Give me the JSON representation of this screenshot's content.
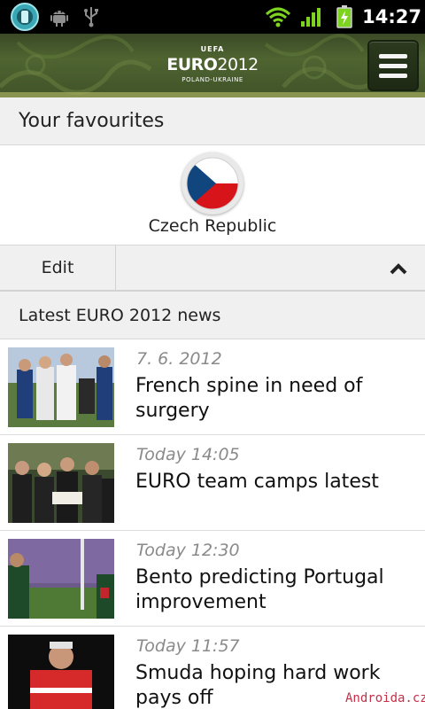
{
  "status_bar": {
    "time": "14:27",
    "icons": [
      "app-notification-icon",
      "android-debug-icon",
      "usb-icon",
      "wifi-icon",
      "signal-icon",
      "battery-charging-icon"
    ]
  },
  "header": {
    "logo": {
      "uefa": "UEFA",
      "title_main": "EURO",
      "title_year": "2012",
      "subtitle": "POLAND-UKRAINE"
    },
    "menu_icon": "hamburger-menu-icon"
  },
  "favourites": {
    "heading": "Your favourites",
    "items": [
      {
        "name": "Czech Republic",
        "flag_colors": [
          "#ffffff",
          "#d7141a",
          "#11457e"
        ]
      }
    ],
    "edit_label": "Edit",
    "collapse_icon": "chevron-up-icon"
  },
  "news": {
    "heading": "Latest EURO 2012 news",
    "items": [
      {
        "date": "7. 6. 2012",
        "headline": "French spine in need of surgery"
      },
      {
        "date": "Today 14:05",
        "headline": "EURO team camps latest"
      },
      {
        "date": "Today 12:30",
        "headline": "Bento predicting Portugal improvement"
      },
      {
        "date": "Today 11:57",
        "headline": "Smuda hoping hard work pays off"
      }
    ]
  },
  "watermark": "Androida.cz",
  "colors": {
    "header_green": "#4f6431",
    "section_bg": "#f1f0f1",
    "date_grey": "#8a8a8a",
    "watermark_red": "#c2304a"
  }
}
